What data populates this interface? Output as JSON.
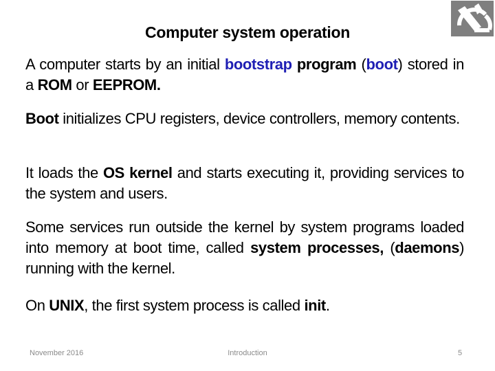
{
  "slide": {
    "title": "Computer system operation",
    "paragraphs": {
      "p1": {
        "t1": "A computer starts  by an initial ",
        "b1": "bootstrap",
        "t2": " ",
        "b2": "program",
        "t3": " (",
        "b3": "boot",
        "t4": ") stored in a ",
        "b4": "ROM",
        "t5": " or ",
        "b5": "EEPROM.",
        "t6": ""
      },
      "p2": {
        "b1": "Boot",
        "t1": " initializes CPU registers, device controllers, memory contents."
      },
      "p3": {
        "t1": "It loads the ",
        "b1": "OS kernel",
        "t2": " and starts executing it, providing services to the system and users."
      },
      "p4": {
        "t1": "Some services run outside the kernel by system programs loaded into memory at boot time, called ",
        "b1": "system processes,",
        "t2": " (",
        "b2": "daemons",
        "t3": ") running with the kernel."
      },
      "p5": {
        "t1": "On ",
        "b1": "UNIX",
        "t2": ", the first system process is called ",
        "b2": "init",
        "t3": "."
      }
    },
    "logo_icon": "institution-logo-icon",
    "colors": {
      "keyword_blue": "#1f1fb4",
      "logo_gray": "#7f7f7f",
      "footer_gray": "#8a8a8a"
    }
  },
  "footer": {
    "date": "November 2016",
    "section": "Introduction",
    "page_number": "5"
  }
}
